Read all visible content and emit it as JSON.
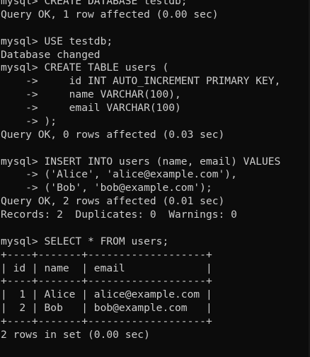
{
  "terminal": {
    "lines": [
      "mysql> CREATE DATABASE testdb;",
      "Query OK, 1 row affected (0.00 sec)",
      "",
      "mysql> USE testdb;",
      "Database changed",
      "mysql> CREATE TABLE users (",
      "    ->     id INT AUTO_INCREMENT PRIMARY KEY,",
      "    ->     name VARCHAR(100),",
      "    ->     email VARCHAR(100)",
      "    -> );",
      "Query OK, 0 rows affected (0.03 sec)",
      "",
      "mysql> INSERT INTO users (name, email) VALUES",
      "    -> ('Alice', 'alice@example.com'),",
      "    -> ('Bob', 'bob@example.com');",
      "Query OK, 2 rows affected (0.01 sec)",
      "Records: 2  Duplicates: 0  Warnings: 0",
      "",
      "mysql> SELECT * FROM users;",
      "+----+-------+-------------------+",
      "| id | name  | email             |",
      "+----+-------+-------------------+",
      "|  1 | Alice | alice@example.com |",
      "|  2 | Bob   | bob@example.com   |",
      "+----+-------+-------------------+",
      "2 rows in set (0.00 sec)"
    ]
  },
  "colors": {
    "background": "#0c0c0c",
    "foreground": "#cccccc"
  }
}
